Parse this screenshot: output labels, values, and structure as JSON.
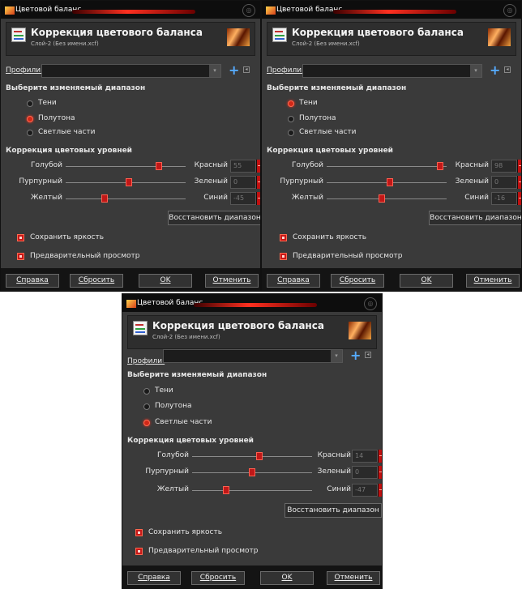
{
  "dialogs": [
    {
      "title": "Цветовой баланс",
      "header_title": "Коррекция цветового баланса",
      "header_subtitle": "Слой-2 (Без имени.xcf)",
      "profiles_label": "Профили:",
      "range_heading": "Выберите изменяемый диапазон",
      "ranges": [
        {
          "label": "Тени",
          "selected": false
        },
        {
          "label": "Полутона",
          "selected": true
        },
        {
          "label": "Светлые части",
          "selected": false
        }
      ],
      "levels_heading": "Коррекция цветовых уровней",
      "sliders": [
        {
          "left": "Голубой",
          "right": "Красный",
          "value": "55"
        },
        {
          "left": "Пурпурный",
          "right": "Зеленый",
          "value": "0"
        },
        {
          "left": "Желтый",
          "right": "Синий",
          "value": "-45"
        }
      ],
      "reset_range": "Восстановить диапазон",
      "preserve_label": "Сохранить яркость",
      "preview_label": "Предварительный просмотр",
      "buttons": {
        "help": "Справка",
        "reset": "Сбросить",
        "ok": "OK",
        "cancel": "Отменить"
      }
    },
    {
      "title": "Цветовой баланс",
      "header_title": "Коррекция цветового баланса",
      "header_subtitle": "Слой-2 (Без имени.xcf)",
      "profiles_label": "Профили:",
      "range_heading": "Выберите изменяемый диапазон",
      "ranges": [
        {
          "label": "Тени",
          "selected": true
        },
        {
          "label": "Полутона",
          "selected": false
        },
        {
          "label": "Светлые части",
          "selected": false
        }
      ],
      "levels_heading": "Коррекция цветовых уровней",
      "sliders": [
        {
          "left": "Голубой",
          "right": "Красный",
          "value": "98"
        },
        {
          "left": "Пурпурный",
          "right": "Зеленый",
          "value": "0"
        },
        {
          "left": "Желтый",
          "right": "Синий",
          "value": "-16"
        }
      ],
      "reset_range": "Восстановить диапазон",
      "preserve_label": "Сохранить яркость",
      "preview_label": "Предварительный просмотр",
      "buttons": {
        "help": "Справка",
        "reset": "Сбросить",
        "ok": "OK",
        "cancel": "Отменить"
      }
    },
    {
      "title": "Цветовой баланс",
      "header_title": "Коррекция цветового баланса",
      "header_subtitle": "Слой-2 (Без имени.xcf)",
      "profiles_label": "Профили:",
      "range_heading": "Выберите изменяемый диапазон",
      "ranges": [
        {
          "label": "Тени",
          "selected": false
        },
        {
          "label": "Полутона",
          "selected": false
        },
        {
          "label": "Светлые части",
          "selected": true
        }
      ],
      "levels_heading": "Коррекция цветовых уровней",
      "sliders": [
        {
          "left": "Голубой",
          "right": "Красный",
          "value": "14"
        },
        {
          "left": "Пурпурный",
          "right": "Зеленый",
          "value": "0"
        },
        {
          "left": "Желтый",
          "right": "Синий",
          "value": "-47"
        }
      ],
      "reset_range": "Восстановить диапазон",
      "preserve_label": "Сохранить яркость",
      "preview_label": "Предварительный просмотр",
      "buttons": {
        "help": "Справка",
        "reset": "Сбросить",
        "ok": "OK",
        "cancel": "Отменить"
      }
    }
  ]
}
